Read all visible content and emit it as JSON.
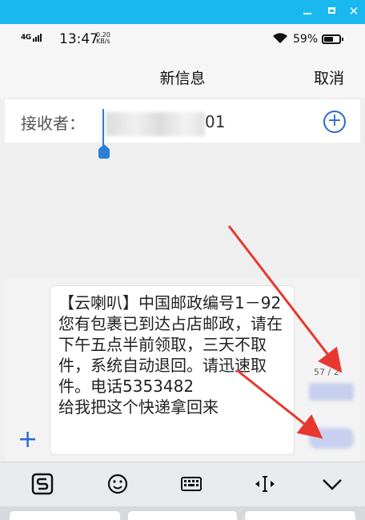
{
  "status_bar": {
    "network": "4G",
    "time": "13:47",
    "speed_value": "0.20",
    "speed_unit": "KB/s",
    "battery_percent": "59%",
    "battery_level": 0.59
  },
  "header": {
    "title": "新信息",
    "cancel_label": "取消"
  },
  "recipient": {
    "label": "接收者：",
    "visible_value": "01"
  },
  "message": {
    "body": "【云喇叭】中国邮政编号1－92您有包裹已到达占店邮政，请在下午五点半前领取，三天不取件，系统自动退回。请迅速取件。电话5353482\n给我把这个快递拿回来"
  },
  "counter": {
    "text": "57 / 2"
  },
  "keyboard": {
    "toolbar_icons": [
      "sogou-icon",
      "emoji-icon",
      "keyboard-icon",
      "cursor-move-icon",
      "collapse-icon"
    ]
  },
  "colors": {
    "titlebar": "#19b9ef",
    "accent": "#2a6ad0",
    "arrow": "#e8372e"
  }
}
